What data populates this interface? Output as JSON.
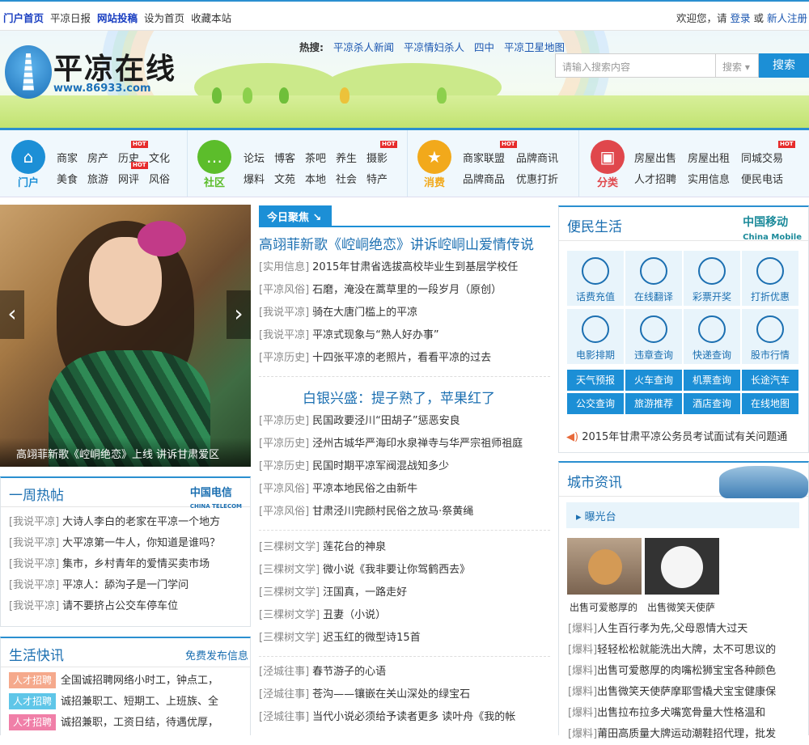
{
  "topbar": {
    "links": [
      "门户首页",
      "平凉日报",
      "网站投稿",
      "设为首页",
      "收藏本站"
    ],
    "welcome": "欢迎您，请",
    "login": "登录",
    "or": "或",
    "register": "新人注册"
  },
  "header": {
    "logo_text": "平凉在线",
    "logo_url": "www.86933.com",
    "hot_label": "热搜:",
    "hot_terms": [
      "平凉杀人新闻",
      "平凉情妇杀人",
      "四中",
      "平凉卫星地图"
    ],
    "search_placeholder": "请输入搜索内容",
    "search_select": "搜索",
    "search_button": "搜索"
  },
  "nav": {
    "groups": [
      {
        "label": "门户",
        "links": [
          "商家",
          "房产",
          "历史",
          "文化",
          "美食",
          "旅游",
          "网评",
          "风俗"
        ],
        "color": "#1c8fd6"
      },
      {
        "label": "社区",
        "links": [
          "论坛",
          "博客",
          "茶吧",
          "养生",
          "摄影",
          "爆料",
          "文苑",
          "本地",
          "社会",
          "特产"
        ],
        "color": "#5cbd2b"
      },
      {
        "label": "消费",
        "links": [
          "商家联盟",
          "品牌商讯",
          "品牌商品",
          "优惠打折"
        ],
        "color": "#f2a91b"
      },
      {
        "label": "分类",
        "links": [
          "房屋出售",
          "房屋出租",
          "同城交易",
          "人才招聘",
          "实用信息",
          "便民电话"
        ],
        "color": "#e0474c"
      }
    ],
    "hot_badge": "HOT"
  },
  "slider": {
    "caption": "高翊菲新歌《崆峒绝恋》上线 讲诉甘肃爱区"
  },
  "focus": {
    "tag": "今日聚焦",
    "headline1": "高翊菲新歌《崆峒绝恋》讲诉崆峒山爱情传说",
    "list1": [
      {
        "cat": "[实用信息]",
        "title": "2015年甘肃省选拔高校毕业生到基层学校任"
      },
      {
        "cat": "[平凉风俗]",
        "title": "石磨，淹没在蒿草里的一段岁月（原创）"
      },
      {
        "cat": "[我说平凉]",
        "title": "骑在大唐门槛上的平凉"
      },
      {
        "cat": "[我说平凉]",
        "title": "平凉式现象与“熟人好办事”"
      },
      {
        "cat": "[平凉历史]",
        "title": "十四张平凉的老照片，看看平凉的过去"
      }
    ],
    "headline2": "白银兴盛：提子熟了，苹果红了",
    "list2": [
      {
        "cat": "[平凉历史]",
        "title": "民国政要泾川“田胡子”惩恶安良"
      },
      {
        "cat": "[平凉历史]",
        "title": "泾州古城华严海印水泉禅寺与华严宗祖师祖庭"
      },
      {
        "cat": "[平凉历史]",
        "title": "民国时期平凉军阀混战知多少"
      },
      {
        "cat": "[平凉风俗]",
        "title": "平凉本地民俗之由新牛"
      },
      {
        "cat": "[平凉风俗]",
        "title": "甘肃泾川完颜村民俗之放马·祭黄绳"
      }
    ],
    "list3": [
      {
        "cat": "[三棵树文学]",
        "title": "莲花台的神泉"
      },
      {
        "cat": "[三棵树文学]",
        "title": "微小说《我非要让你驾鹤西去》"
      },
      {
        "cat": "[三棵树文学]",
        "title": "汪国真，一路走好"
      },
      {
        "cat": "[三棵树文学]",
        "title": "丑妻（小说）"
      },
      {
        "cat": "[三棵树文学]",
        "title": "迟玉红的微型诗15首"
      }
    ],
    "list4": [
      {
        "cat": "[泾城往事]",
        "title": "春节游子的心语"
      },
      {
        "cat": "[泾城往事]",
        "title": "苍沟——镶嵌在关山深处的绿宝石"
      },
      {
        "cat": "[泾城往事]",
        "title": "当代小说必须给予读者更多 读叶舟《我的帐"
      }
    ]
  },
  "weekly": {
    "title": "一周热帖",
    "sponsor": "中国电信",
    "sponsor_en": "CHINA TELECOM",
    "items": [
      {
        "cat": "[我说平凉]",
        "title": "大诗人李白的老家在平凉一个地方"
      },
      {
        "cat": "[我说平凉]",
        "title": "大平凉第一牛人，你知道是谁吗？"
      },
      {
        "cat": "[我说平凉]",
        "title": "集市，乡村青年的爱情买卖市场"
      },
      {
        "cat": "[我说平凉]",
        "title": "平凉人：舔沟子是一门学问"
      },
      {
        "cat": "[我说平凉]",
        "title": "请不要挤占公交车停车位"
      }
    ]
  },
  "life": {
    "title": "生活快讯",
    "publish": "免费发布信息",
    "items": [
      {
        "tag": "人才招聘",
        "title": "全国诚招聘网络小时工，钟点工，",
        "color": "#f5a98c"
      },
      {
        "tag": "人才招聘",
        "title": "诚招兼职工、短期工、上班族、全",
        "color": "#5fc6e8"
      },
      {
        "tag": "人才招聘",
        "title": "诚招兼职，工资日结，待遇优厚，",
        "color": "#f07fa8"
      }
    ]
  },
  "convenience": {
    "title": "便民生活",
    "sponsor": "中国移动",
    "sponsor_en": "China Mobile",
    "services": [
      "话费充值",
      "在线翻译",
      "彩票开奖",
      "打折优惠",
      "电影排期",
      "违章查询",
      "快递查询",
      "股市行情"
    ],
    "quick": [
      "天气预报",
      "火车查询",
      "机票查询",
      "长途汽车",
      "公交查询",
      "旅游推荐",
      "酒店查询",
      "在线地图"
    ],
    "notice": "2015年甘肃平凉公务员考试面试有关问题通"
  },
  "city": {
    "title": "城市资讯",
    "subtitle": "曝光台",
    "pets": [
      "出售可爱憨厚的",
      "出售微笑天使萨"
    ],
    "items": [
      {
        "cat": "[爆料]",
        "title": "人生百行孝为先,父母恩情大过天"
      },
      {
        "cat": "[爆料]",
        "title": "轻轻松松就能洗出大牌，太不可思议的"
      },
      {
        "cat": "[爆料]",
        "title": "出售可爱憨厚的肉嘴松狮宝宝各种颜色"
      },
      {
        "cat": "[爆料]",
        "title": "出售微笑天使萨摩耶雪橇犬宝宝健康保"
      },
      {
        "cat": "[爆料]",
        "title": "出售拉布拉多犬嘴宽骨量大性格温和"
      },
      {
        "cat": "[爆料]",
        "title": "莆田高质量大牌运动潮鞋招代理，批发"
      }
    ]
  }
}
